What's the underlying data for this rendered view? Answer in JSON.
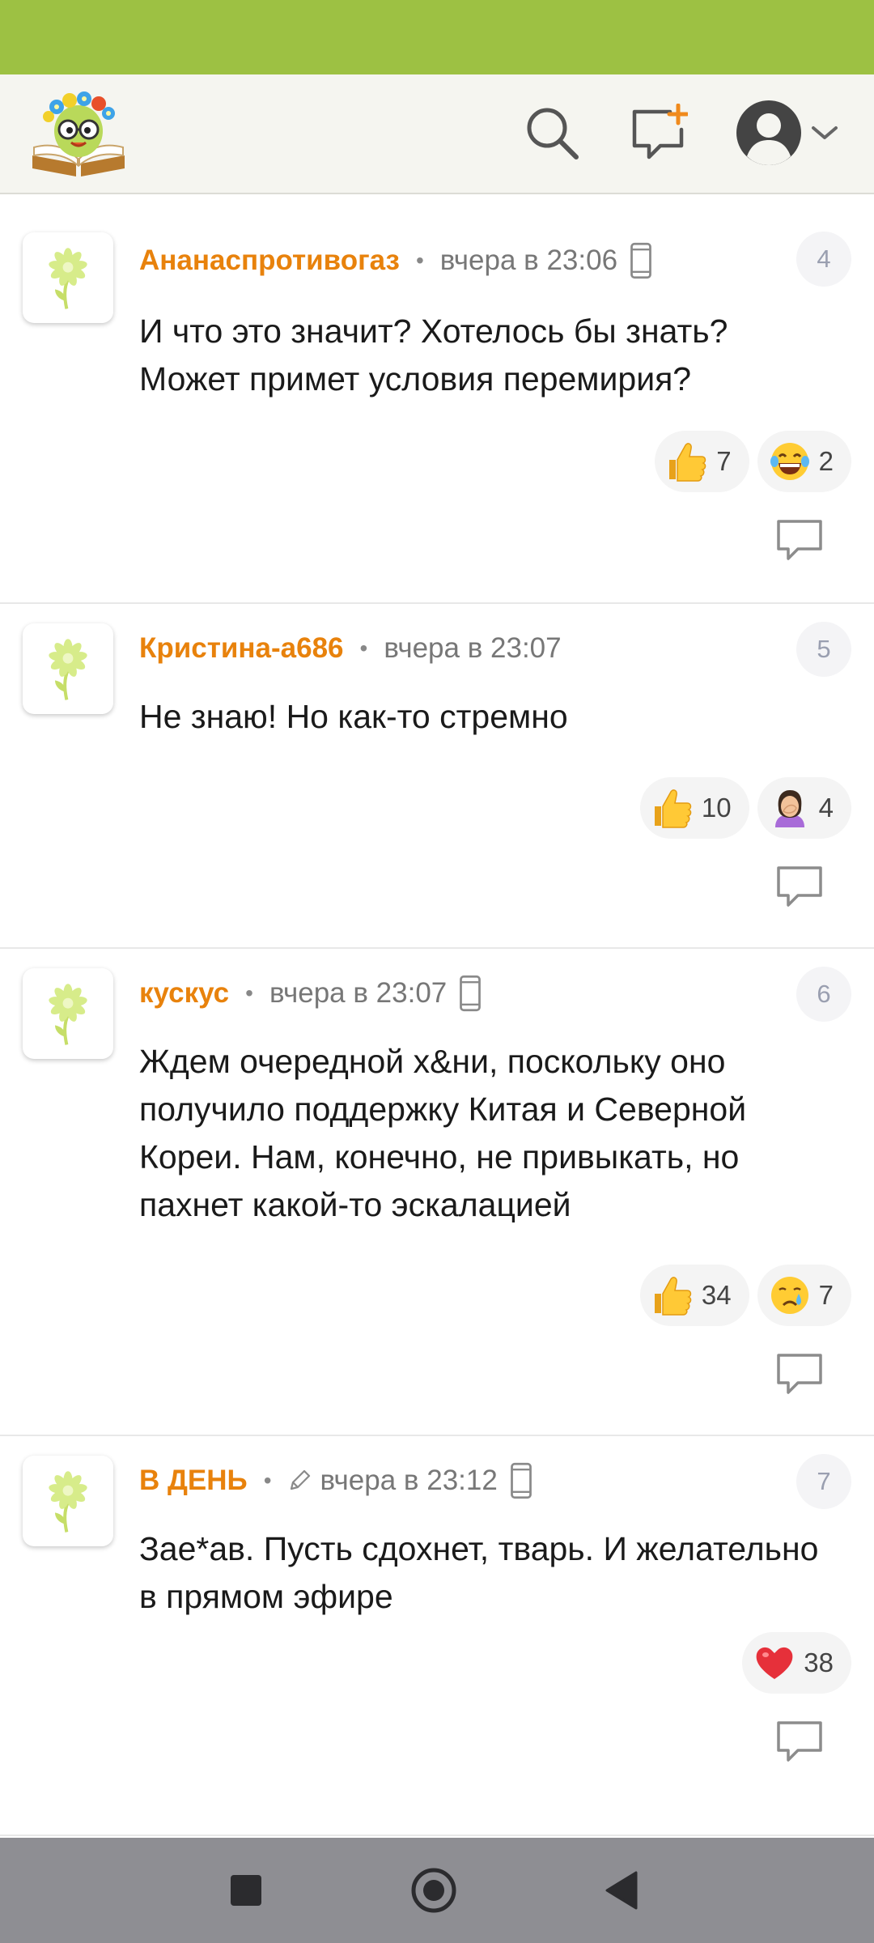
{
  "header": {
    "logo": "book-mascot-logo",
    "icons": [
      "search-icon",
      "new-post-icon",
      "account-icon",
      "chevron-down-icon"
    ]
  },
  "comments": [
    {
      "number": "4",
      "author": "Ананаспротивогаз",
      "time": "вчера в 23:06",
      "text": "И что это значит? Хотелось бы знать? Может примет условия перемирия?",
      "reactions": [
        {
          "emoji": "thumbs-up",
          "count": "7"
        },
        {
          "emoji": "tears-of-joy",
          "count": "2"
        }
      ]
    },
    {
      "number": "5",
      "author": "Кристина-а686",
      "time": "вчера в 23:07",
      "text": "Не знаю! Но как-то стремно",
      "reactions": [
        {
          "emoji": "thumbs-up",
          "count": "10"
        },
        {
          "emoji": "facepalm",
          "count": "4"
        }
      ]
    },
    {
      "number": "6",
      "author": "кускус",
      "time": "вчера в 23:07",
      "text": "Ждем очередной х&ни, поскольку оно получило поддержку Китая и Северной Кореи. Нам, конечно, не привыкать, но пахнет какой-то эскалацией",
      "reactions": [
        {
          "emoji": "thumbs-up",
          "count": "34"
        },
        {
          "emoji": "crying",
          "count": "7"
        }
      ]
    },
    {
      "number": "7",
      "author": "В ДЕНЬ",
      "time": "вчера в 23:12",
      "text": "Зае*ав. Пусть сдохнет, тварь. И желательно в прямом эфире",
      "reactions": [
        {
          "emoji": "red-heart",
          "count": "38"
        }
      ]
    }
  ],
  "colors": {
    "status_bar": "#9dc143",
    "author": "#e8820c",
    "nav_bar": "#8e8e93"
  }
}
